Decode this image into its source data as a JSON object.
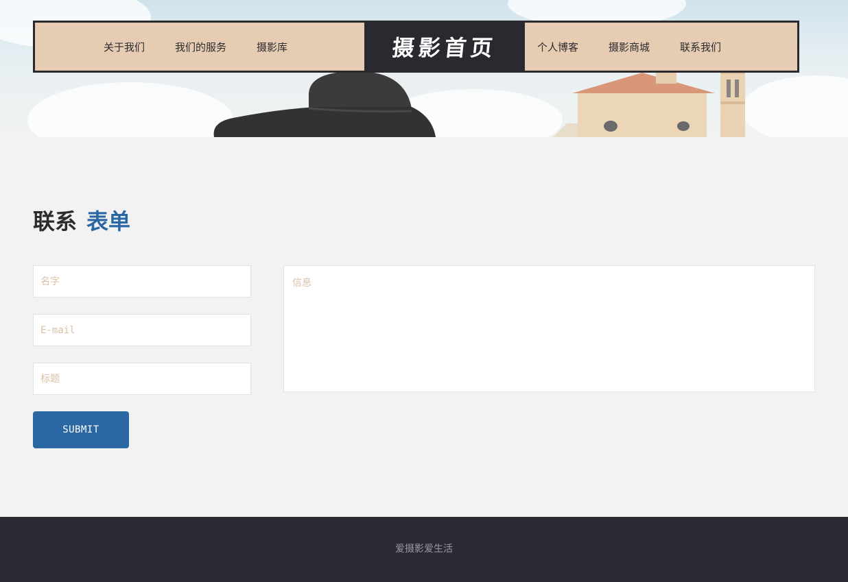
{
  "nav": {
    "left_links": [
      "关于我们",
      "我们的服务",
      "摄影库"
    ],
    "brand": "摄影首页",
    "right_links": [
      "个人博客",
      "摄影商城",
      "联系我们"
    ]
  },
  "contact": {
    "heading_dark": "联系",
    "heading_accent": "表单",
    "name_placeholder": "名字",
    "email_placeholder": "E-mail",
    "subject_placeholder": "标题",
    "message_placeholder": "信息",
    "submit_label": "SUBMIT"
  },
  "footer": {
    "text": "爱摄影爱生活"
  },
  "colors": {
    "accent": "#2b68a3",
    "nav_bg": "#e7ccb4",
    "dark": "#2a2930",
    "placeholder": "#d9c1a6"
  },
  "icons": {
    "hero_hat": "hat-image",
    "hero_building": "building-image"
  }
}
